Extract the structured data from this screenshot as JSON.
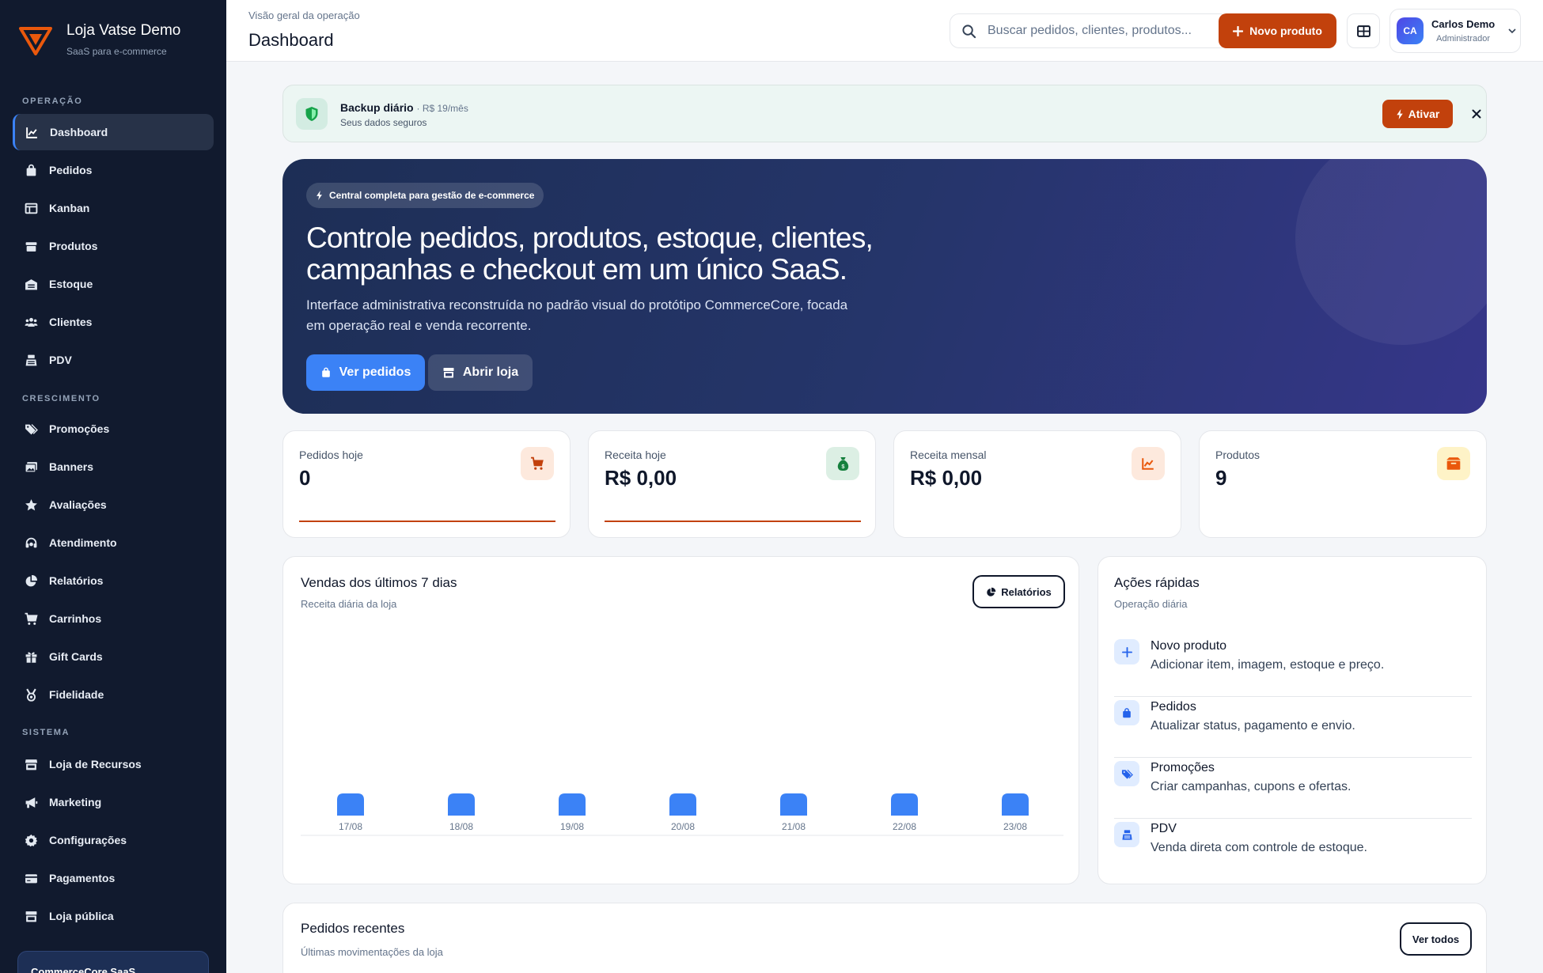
{
  "sidebar": {
    "brand_name": "Loja Vatse Demo",
    "brand_sub": "SaaS para e-commerce",
    "sections": [
      "OPERAÇÃO",
      "CRESCIMENTO",
      "SISTEMA"
    ],
    "items": [
      {
        "label": "Dashboard",
        "icon": "chart-line-icon",
        "active": true
      },
      {
        "label": "Pedidos",
        "icon": "shopping-bag-icon"
      },
      {
        "label": "Kanban",
        "icon": "kanban-icon"
      },
      {
        "label": "Produtos",
        "icon": "box-icon"
      },
      {
        "label": "Estoque",
        "icon": "warehouse-icon"
      },
      {
        "label": "Clientes",
        "icon": "users-icon"
      },
      {
        "label": "PDV",
        "icon": "cash-register-icon"
      },
      {
        "label": "Promoções",
        "icon": "tags-icon"
      },
      {
        "label": "Banners",
        "icon": "images-icon"
      },
      {
        "label": "Avaliações",
        "icon": "star-icon"
      },
      {
        "label": "Atendimento",
        "icon": "headset-icon"
      },
      {
        "label": "Relatórios",
        "icon": "pie-chart-icon"
      },
      {
        "label": "Carrinhos",
        "icon": "cart-icon"
      },
      {
        "label": "Gift Cards",
        "icon": "gift-icon"
      },
      {
        "label": "Fidelidade",
        "icon": "medal-icon"
      },
      {
        "label": "Loja de Recursos",
        "icon": "store-icon"
      },
      {
        "label": "Marketing",
        "icon": "megaphone-icon"
      },
      {
        "label": "Configurações",
        "icon": "gear-icon"
      },
      {
        "label": "Pagamentos",
        "icon": "credit-card-icon"
      },
      {
        "label": "Loja pública",
        "icon": "shop-icon"
      }
    ],
    "footer_label": "CommerceCore SaaS"
  },
  "header": {
    "breadcrumb": "Visão geral da operação",
    "title": "Dashboard",
    "search_placeholder": "Buscar pedidos, clientes, produtos...",
    "new_product_label": "Novo produto",
    "user_initials": "CA",
    "user_name": "Carlos Demo",
    "user_role": "Administrador"
  },
  "backup": {
    "title": "Backup diário",
    "price": "· R$ 19/mês",
    "subtitle": "Seus dados seguros",
    "activate_label": "Ativar"
  },
  "hero": {
    "badge": "Central completa para gestão de e-commerce",
    "title": "Controle pedidos, produtos, estoque, clientes, campanhas e checkout em um único SaaS.",
    "description": "Interface administrativa reconstruída no padrão visual do protótipo CommerceCore, focada em operação real e venda recorrente.",
    "primary_button": "Ver pedidos",
    "secondary_button": "Abrir loja"
  },
  "stats": [
    {
      "label": "Pedidos hoje",
      "value": "0",
      "icon": "cart-icon",
      "color": "#c2410c",
      "bg": "#fde9dd"
    },
    {
      "label": "Receita hoje",
      "value": "R$ 0,00",
      "icon": "money-bag-icon",
      "color": "#15803d",
      "bg": "#dcefe4"
    },
    {
      "label": "Receita mensal",
      "value": "R$ 0,00",
      "icon": "chart-line-icon",
      "color": "#ea580c",
      "bg": "#fde9dd"
    },
    {
      "label": "Produtos",
      "value": "9",
      "icon": "box-icon",
      "color": "#ea580c",
      "bg": "#fef3c7"
    }
  ],
  "sales": {
    "title": "Vendas dos últimos 7 dias",
    "subtitle": "Receita diária da loja",
    "reports_button": "Relatórios"
  },
  "chart_data": {
    "type": "bar",
    "title": "Vendas dos últimos 7 dias",
    "categories": [
      "17/08",
      "18/08",
      "19/08",
      "20/08",
      "21/08",
      "22/08",
      "23/08"
    ],
    "values": [
      0,
      0,
      0,
      0,
      0,
      0,
      0
    ],
    "bar_color": "#3b82f6",
    "grid": false
  },
  "actions": {
    "title": "Ações rápidas",
    "subtitle": "Operação diária",
    "items": [
      {
        "title": "Novo produto",
        "desc": "Adicionar item, imagem, estoque e preço.",
        "icon": "plus-icon"
      },
      {
        "title": "Pedidos",
        "desc": "Atualizar status, pagamento e envio.",
        "icon": "shopping-bag-icon"
      },
      {
        "title": "Promoções",
        "desc": "Criar campanhas, cupons e ofertas.",
        "icon": "tags-icon"
      },
      {
        "title": "PDV",
        "desc": "Venda direta com controle de estoque.",
        "icon": "cash-register-icon"
      }
    ]
  },
  "recent": {
    "title": "Pedidos recentes",
    "subtitle": "Últimas movimentações da loja",
    "view_all": "Ver todos"
  }
}
